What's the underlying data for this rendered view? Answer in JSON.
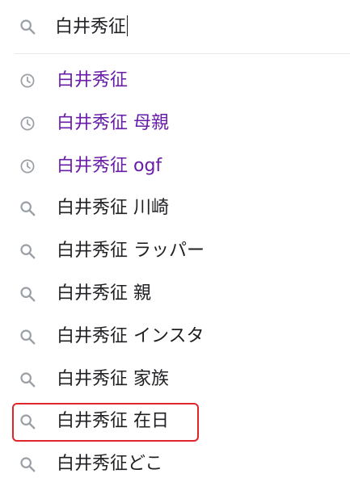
{
  "search": {
    "query": "白井秀征",
    "icon": "search-icon"
  },
  "suggestions": [
    {
      "text": "白井秀征",
      "kind": "history",
      "icon": "clock-icon"
    },
    {
      "text": "白井秀征 母親",
      "kind": "history",
      "icon": "clock-icon"
    },
    {
      "text": "白井秀征 ogf",
      "kind": "history",
      "icon": "clock-icon"
    },
    {
      "text": "白井秀征 川崎",
      "kind": "search",
      "icon": "search-icon"
    },
    {
      "text": "白井秀征 ラッパー",
      "kind": "search",
      "icon": "search-icon"
    },
    {
      "text": "白井秀征 親",
      "kind": "search",
      "icon": "search-icon"
    },
    {
      "text": "白井秀征 インスタ",
      "kind": "search",
      "icon": "search-icon"
    },
    {
      "text": "白井秀征 家族",
      "kind": "search",
      "icon": "search-icon"
    },
    {
      "text": "白井秀征 在日",
      "kind": "search",
      "icon": "search-icon",
      "highlighted": true
    },
    {
      "text": "白井秀征どこ",
      "kind": "search",
      "icon": "search-icon"
    }
  ],
  "colors": {
    "history_text": "#681da8",
    "suggestion_text": "#202124",
    "icon": "#9aa0a6",
    "highlight_border": "#e0262b"
  }
}
